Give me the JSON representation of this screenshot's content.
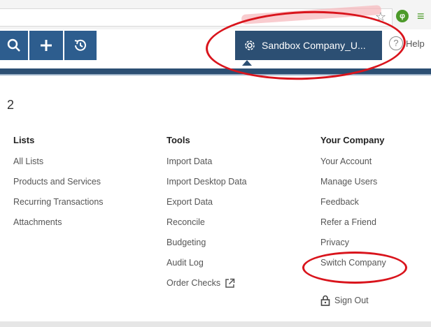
{
  "navbar": {
    "company_name": "Sandbox Company_U...",
    "help_label": "Help",
    "colors": {
      "nav_blue": "#2d5d8e",
      "company_dark": "#2c4f73",
      "annotation_red": "#d9141c"
    },
    "icons": [
      "search-icon",
      "plus-icon",
      "recent-clock-icon",
      "gear-icon",
      "help-icon",
      "star-icon"
    ]
  },
  "menu": {
    "number_label": "2",
    "lists": {
      "title": "Lists",
      "items": [
        "All Lists",
        "Products and Services",
        "Recurring Transactions",
        "Attachments"
      ]
    },
    "tools": {
      "title": "Tools",
      "items": [
        "Import Data",
        "Import Desktop Data",
        "Export Data",
        "Reconcile",
        "Budgeting",
        "Audit Log",
        "Order Checks"
      ]
    },
    "your_company": {
      "title": "Your Company",
      "items": [
        "Your Account",
        "Manage Users",
        "Feedback",
        "Refer a Friend",
        "Privacy",
        "Switch Company"
      ]
    },
    "sign_out": "Sign Out"
  }
}
